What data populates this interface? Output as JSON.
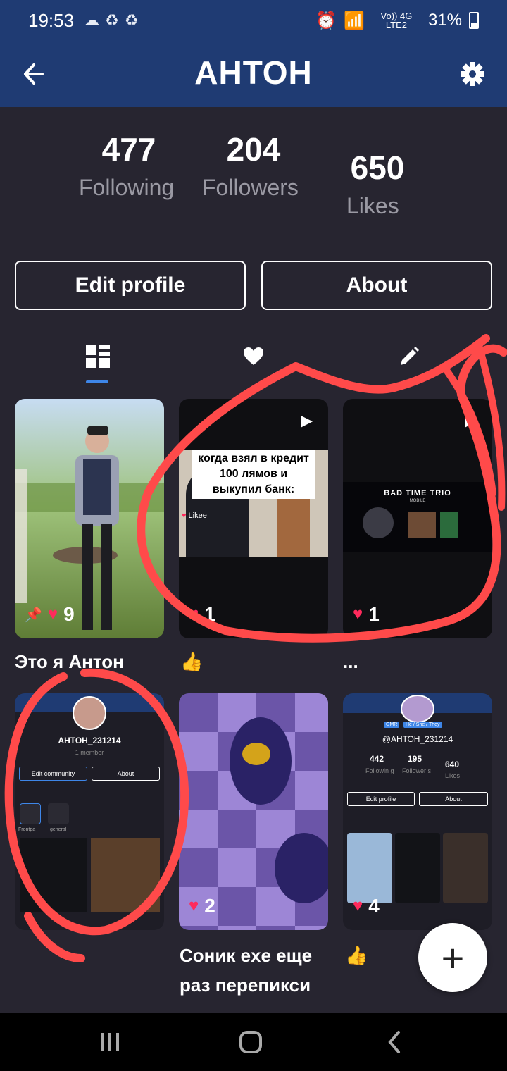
{
  "status_bar": {
    "time": "19:53",
    "network": "Vo)) 4G LTE2",
    "battery": "31%"
  },
  "header": {
    "title": "АНТОН"
  },
  "stats": [
    {
      "value": "477",
      "label": "Following"
    },
    {
      "value": "204",
      "label": "Followers"
    },
    {
      "value": "650",
      "label": "Likes"
    }
  ],
  "buttons": {
    "edit_profile": "Edit profile",
    "about": "About"
  },
  "tabs": [
    {
      "icon": "grid-icon",
      "active": true
    },
    {
      "icon": "heart-icon",
      "active": false
    },
    {
      "icon": "pencil-icon",
      "active": false
    }
  ],
  "posts": [
    {
      "likes": "9",
      "caption": "Это я Антон",
      "pinned": true
    },
    {
      "likes": "1",
      "caption": "👍",
      "overlay_text": "когда взял в кредит 100 лямов и выкупил банк:",
      "watermark": "Likee"
    },
    {
      "likes": "1",
      "caption": "...",
      "game_title": "BAD TIME TRIO",
      "game_subtitle": "MOBILE"
    },
    {
      "likes": "",
      "caption": "",
      "community_name": "АНТОН_231214",
      "community_members": "1 member",
      "edit_community": "Edit community",
      "about": "About",
      "channel_1": "Frontpa",
      "channel_2": "general"
    },
    {
      "likes": "2",
      "caption": "Соник exe еще раз перепикси рован"
    },
    {
      "likes": "4",
      "caption": "👍",
      "mini_handle": "@АНТОН_231214",
      "mini_badge_1": "GMR",
      "mini_badge_2": "He / She / They",
      "mini_following": "442",
      "mini_followers": "195",
      "mini_likes": "640",
      "mini_following_label": "Followin g",
      "mini_followers_label": "Follower s",
      "mini_likes_label": "Likes",
      "mini_edit": "Edit profile",
      "mini_about": "About"
    }
  ],
  "fab": {
    "icon": "plus-icon"
  },
  "colors": {
    "header_bg": "#1f3b73",
    "page_bg": "#272530",
    "heart": "#ff2a5c",
    "accent": "#3e86e8",
    "annotation": "#ff4a4a"
  }
}
